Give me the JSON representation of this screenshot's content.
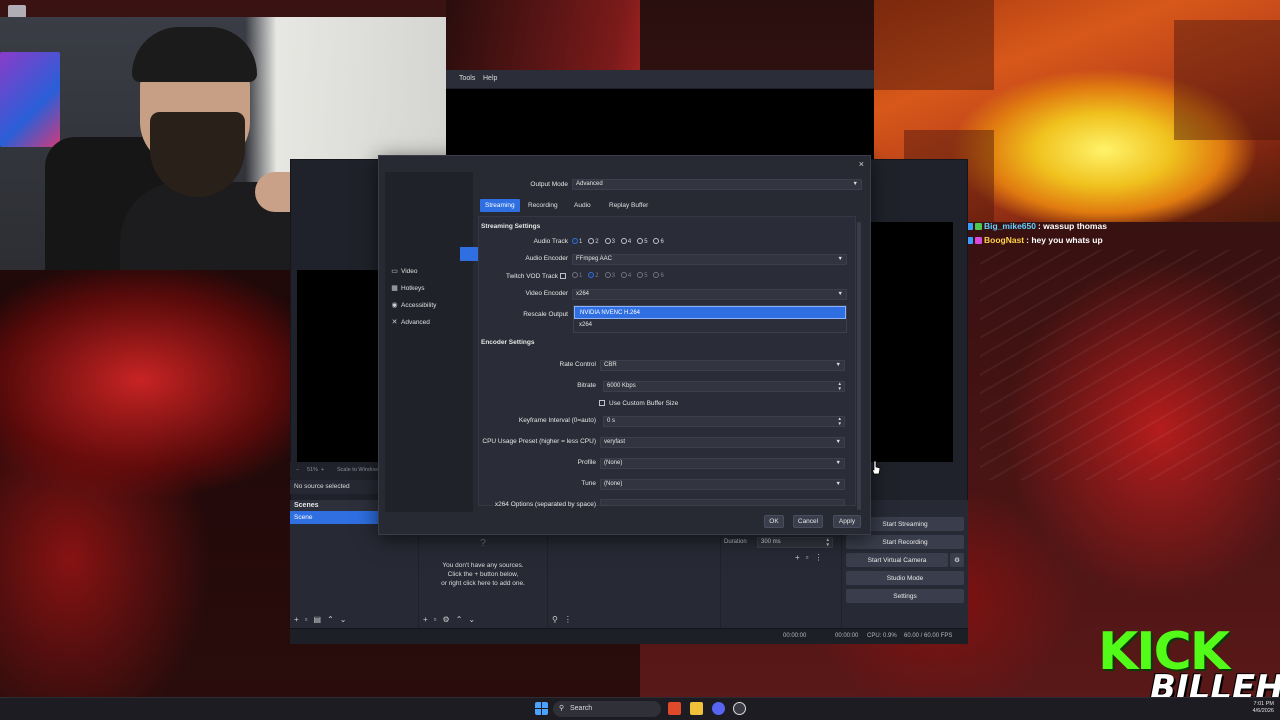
{
  "menu": {
    "items": [
      "Tools",
      "Help"
    ]
  },
  "chat": [
    {
      "user": "Big_mike650",
      "message": " : wassup thomas"
    },
    {
      "user": "BoogNast",
      "message": " : hey you whats up"
    }
  ],
  "preview": {
    "zoom": "51%",
    "scale_label": "Scale to Window",
    "no_source": "No source selected"
  },
  "scenes": {
    "title": "Scenes",
    "items": [
      "Scene"
    ]
  },
  "sources": {
    "empty_line1": "You don't have any sources.",
    "empty_line2": "Click the + button below,",
    "empty_line3": "or right click here to add one."
  },
  "transitions": {
    "duration_label": "Duration",
    "duration_value": "300 ms"
  },
  "controls": {
    "buttons": [
      "Start Streaming",
      "Start Recording",
      "Start Virtual Camera",
      "Studio Mode",
      "Settings"
    ]
  },
  "status": {
    "time1": "00:00:00",
    "time2": "00:00:00",
    "cpu": "CPU: 0.9%",
    "fps": "60.00 / 60.00 FPS"
  },
  "settings": {
    "sidebar": [
      "Video",
      "Hotkeys",
      "Accessibility",
      "Advanced"
    ],
    "output_mode_label": "Output Mode",
    "output_mode_value": "Advanced",
    "tabs": [
      "Streaming",
      "Recording",
      "Audio",
      "Replay Buffer"
    ],
    "streaming_section": "Streaming Settings",
    "audio_track_label": "Audio Track",
    "audio_tracks": [
      "1",
      "2",
      "3",
      "4",
      "5",
      "6"
    ],
    "audio_encoder_label": "Audio Encoder",
    "audio_encoder_value": "FFmpeg AAC",
    "twitch_vod_label": "Twitch VOD Track",
    "video_encoder_label": "Video Encoder",
    "video_encoder_value": "x264",
    "rescale_label": "Rescale Output",
    "encoder_options": [
      "NVIDIA NVENC H.264",
      "x264"
    ],
    "encoder_section": "Encoder Settings",
    "rate_control_label": "Rate Control",
    "rate_control_value": "CBR",
    "bitrate_label": "Bitrate",
    "bitrate_value": "6000 Kbps",
    "custom_buffer_label": "Use Custom Buffer Size",
    "keyframe_label": "Keyframe Interval (0=auto)",
    "keyframe_value": "0 s",
    "cpu_preset_label": "CPU Usage Preset (higher = less CPU)",
    "cpu_preset_value": "veryfast",
    "profile_label": "Profile",
    "profile_value": "(None)",
    "tune_label": "Tune",
    "tune_value": "(None)",
    "x264_options_label": "x264 Options (separated by space)",
    "ok": "OK",
    "cancel": "Cancel",
    "apply": "Apply",
    "close": "×"
  },
  "taskbar": {
    "search_placeholder": "Search",
    "time": "7:01 PM",
    "date": "4/6/2026"
  },
  "branding": {
    "kick": "KICK",
    "name": "BILLEH"
  },
  "colors": {
    "accent": "#2f6fe2",
    "kick_green": "#53fc18"
  }
}
